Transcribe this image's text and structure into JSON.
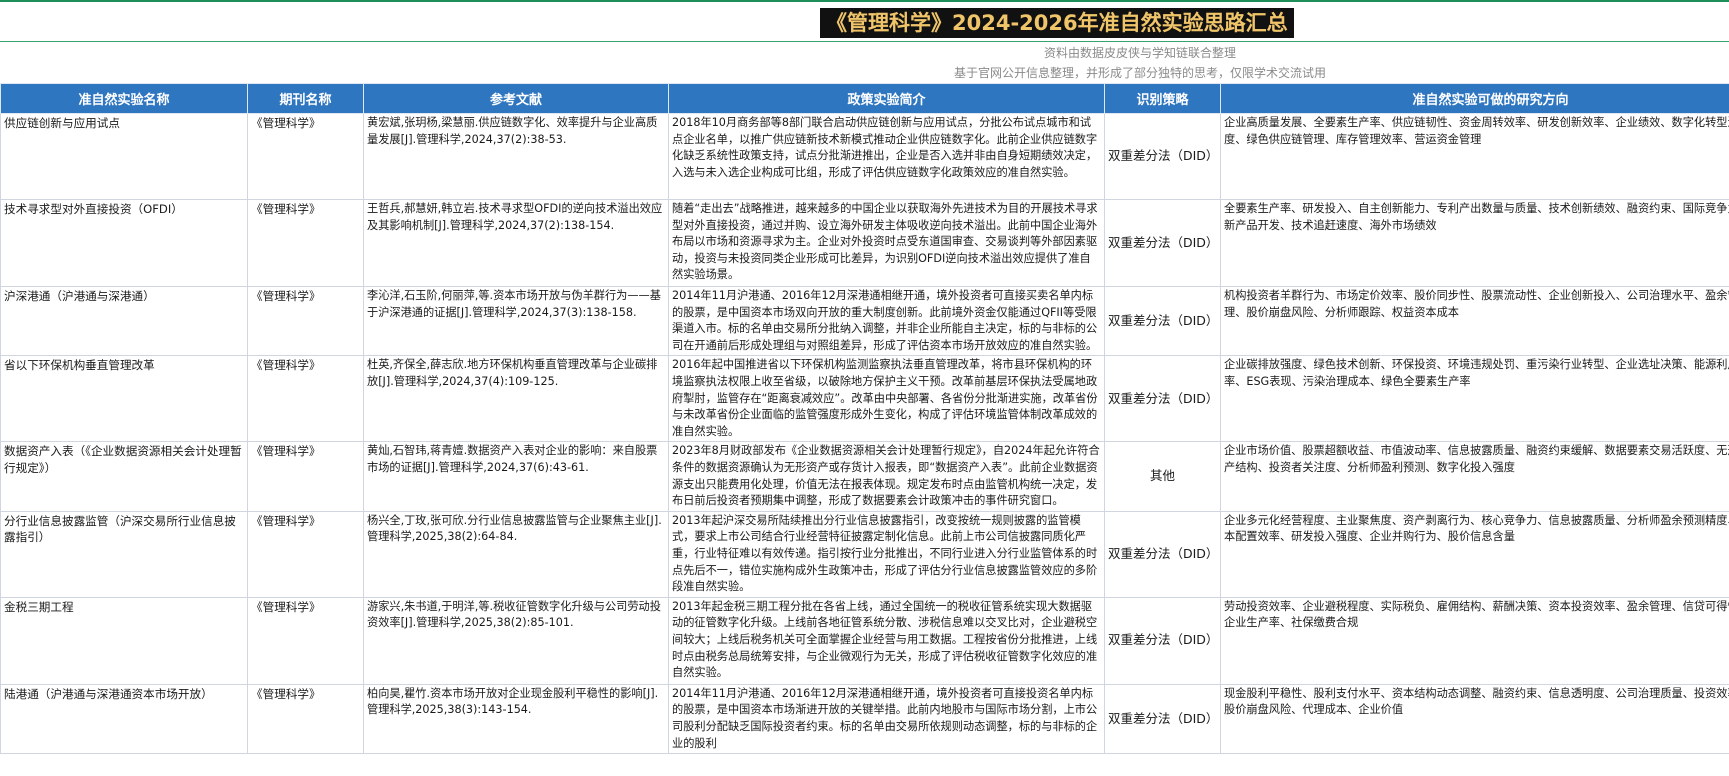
{
  "header": {
    "title": "《管理科学》2024-2026年准自然实验思路汇总",
    "subtitle_1": "资料由数据皮皮侠与学知链联合整理",
    "subtitle_2": "基于官网公开信息整理，并形成了部分独特的思考，仅限学术交流试用"
  },
  "table": {
    "columns": [
      "准自然实验名称",
      "期刊名称",
      "参考文献",
      "政策实验简介",
      "识别策略",
      "准自然实验可做的研究方向"
    ],
    "rows": [
      {
        "name": "供应链创新与应用试点",
        "journal": "《管理科学》",
        "reference": "黄宏斌,张玥杨,梁慧丽.供应链数字化、效率提升与企业高质量发展[J].管理科学,2024,37(2):38-53.",
        "policy": "2018年10月商务部等8部门联合启动供应链创新与应用试点，分批公布试点城市和试点企业名单，以推广供应链新技术新模式推动企业供应链数字化。此前企业供应链数字化缺乏系统性政策支持，试点分批渐进推出，企业是否入选并非由自身短期绩效决定，入选与未入选企业构成可比组，形成了评估供应链数字化政策效应的准自然实验。",
        "strategy": "双重差分法（DID）",
        "directions": "企业高质量发展、全要素生产率、供应链韧性、资金周转效率、研发创新效率、企业绩效、数字化转型深度、绿色供应链管理、库存管理效率、营运资金管理"
      },
      {
        "name": "技术寻求型对外直接投资（OFDI）",
        "journal": "《管理科学》",
        "reference": "王哲兵,郝慧妍,韩立岩.技术寻求型OFDI的逆向技术溢出效应及其影响机制[J].管理科学,2024,37(2):138-154.",
        "policy": "随着“走出去”战略推进，越来越多的中国企业以获取海外先进技术为目的开展技术寻求型对外直接投资，通过并购、设立海外研发主体吸收逆向技术溢出。此前中国企业海外布局以市场和资源寻求为主。企业对外投资时点受东道国审查、交易谈判等外部因素驱动，投资与未投资同类企业形成可比差异，为识别OFDI逆向技术溢出效应提供了准自然实验场景。",
        "strategy": "双重差分法（DID）",
        "directions": "全要素生产率、研发投入、自主创新能力、专利产出数量与质量、技术创新绩效、融资约束、国际竞争力、新产品开发、技术追赶速度、海外市场绩效"
      },
      {
        "name": "沪深港通（沪港通与深港通）",
        "journal": "《管理科学》",
        "reference": "李沁洋,石玉阶,何丽萍,等.资本市场开放与伪羊群行为——基于沪深港通的证据[J].管理科学,2024,37(3):138-158.",
        "policy": "2014年11月沪港通、2016年12月深港通相继开通，境外投资者可直接买卖名单内标的股票，是中国资本市场双向开放的重大制度创新。此前境外资金仅能通过QFII等受限渠道入市。标的名单由交易所分批纳入调整，并非企业所能自主决定，标的与非标的公司在开通前后形成处理组与对照组差异，形成了评估资本市场开放效应的准自然实验。",
        "strategy": "双重差分法（DID）",
        "directions": "机构投资者羊群行为、市场定价效率、股价同步性、股票流动性、企业创新投入、公司治理水平、盈余管理、股价崩盘风险、分析师跟踪、权益资本成本"
      },
      {
        "name": "省以下环保机构垂直管理改革",
        "journal": "《管理科学》",
        "reference": "杜英,齐保全,薛志欣.地方环保机构垂直管理改革与企业碳排放[J].管理科学,2024,37(4):109-125.",
        "policy": "2016年起中国推进省以下环保机构监测监察执法垂直管理改革，将市县环保机构的环境监察执法权限上收至省级，以破除地方保护主义干预。改革前基层环保执法受属地政府掣肘，监管存在“距离衰减效应”。改革由中央部署、各省份分批渐进实施，改革省份与未改革省份企业面临的监管强度形成外生变化，构成了评估环境监管体制改革成效的准自然实验。",
        "strategy": "双重差分法（DID）",
        "directions": "企业碳排放强度、绿色技术创新、环保投资、环境违规处罚、重污染行业转型、企业选址决策、能源利用效率、ESG表现、污染治理成本、绿色全要素生产率"
      },
      {
        "name": "数据资产入表（《企业数据资源相关会计处理暂行规定》）",
        "journal": "《管理科学》",
        "reference": "黄灿,石智玮,蒋青嬗.数据资产入表对企业的影响：来自股票市场的证据[J].管理科学,2024,37(6):43-61.",
        "policy": "2023年8月财政部发布《企业数据资源相关会计处理暂行规定》，自2024年起允许符合条件的数据资源确认为无形资产或存货计入报表，即“数据资产入表”。此前企业数据资源支出只能费用化处理，价值无法在报表体现。规定发布时点由监管机构统一决定，发布日前后投资者预期集中调整，形成了数据要素会计政策冲击的事件研究窗口。",
        "strategy": "其他",
        "directions": "企业市场价值、股票超额收益、市值波动率、信息披露质量、融资约束缓解、数据要素交易活跃度、无形资产结构、投资者关注度、分析师盈利预测、数字化投入强度"
      },
      {
        "name": "分行业信息披露监管（沪深交易所行业信息披露指引）",
        "journal": "《管理科学》",
        "reference": "杨兴全,丁玫,张可欣.分行业信息披露监管与企业聚焦主业[J].管理科学,2025,38(2):64-84.",
        "policy": "2013年起沪深交易所陆续推出分行业信息披露指引，改变按统一规则披露的监管模式，要求上市公司结合行业经营特征披露定制化信息。此前上市公司信披露同质化严重，行业特征难以有效传递。指引按行业分批推出，不同行业进入分行业监管体系的时点先后不一，错位实施构成外生政策冲击，形成了评估分行业信息披露监管效应的多阶段准自然实验。",
        "strategy": "双重差分法（DID）",
        "directions": "企业多元化经营程度、主业聚焦度、资产剥离行为、核心竞争力、信息披露质量、分析师盈余预测精度、资本配置效率、研发投入强度、企业并购行为、股价信息含量"
      },
      {
        "name": "金税三期工程",
        "journal": "《管理科学》",
        "reference": "游家兴,朱书道,于明洋,等.税收征管数字化升级与公司劳动投资效率[J].管理科学,2025,38(2):85-101.",
        "policy": "2013年起金税三期工程分批在各省上线，通过全国统一的税收征管系统实现大数据驱动的征管数字化升级。上线前各地征管系统分散、涉税信息难以交叉比对，企业避税空间较大；上线后税务机关可全面掌握企业经营与用工数据。工程按省份分批推进，上线时点由税务总局统筹安排，与企业微观行为无关，形成了评估税收征管数字化效应的准自然实验。",
        "strategy": "双重差分法（DID）",
        "directions": "劳动投资效率、企业避税程度、实际税负、雇佣结构、薪酬决策、资本投资效率、盈余管理、信贷可得性、企业生产率、社保缴费合规"
      },
      {
        "name": "陆港通（沪港通与深港通资本市场开放）",
        "journal": "《管理科学》",
        "reference": "柏向昊,瞿竹.资本市场开放对企业现金股利平稳性的影响[J].管理科学,2025,38(3):143-154.",
        "policy": "2014年11月沪港通、2016年12月深港通相继开通，境外投资者可直接投资名单内标的股票，是中国资本市场渐进开放的关键举措。此前内地股市与国际市场分割，上市公司股利分配缺乏国际投资者约束。标的名单由交易所依规则动态调整，标的与非标的企业的股利",
        "strategy": "双重差分法（DID）",
        "directions": "现金股利平稳性、股利支付水平、资本结构动态调整、融资约束、信息透明度、公司治理质量、投资效率、股价崩盘风险、代理成本、企业价值"
      }
    ]
  }
}
